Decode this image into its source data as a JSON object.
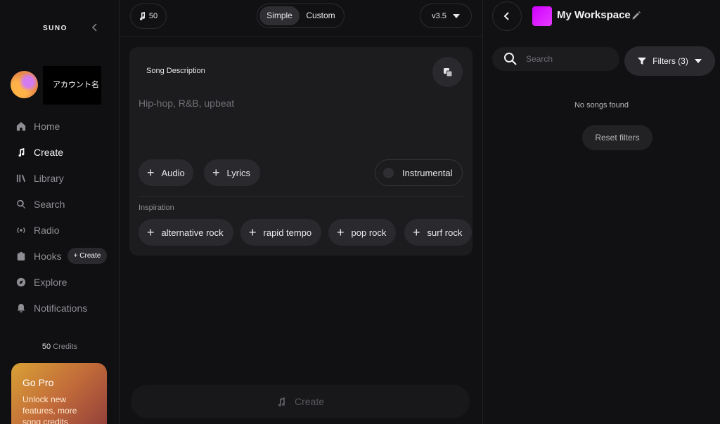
{
  "sidebar": {
    "logo": "SUNO",
    "collapse_icon": "chevron-left-icon",
    "account_name": "アカウント名",
    "nav": [
      {
        "label": "Home",
        "icon": "home-icon"
      },
      {
        "label": "Create",
        "icon": "music-sparkle-icon",
        "active": true
      },
      {
        "label": "Library",
        "icon": "library-icon"
      },
      {
        "label": "Search",
        "icon": "search-icon"
      },
      {
        "label": "Radio",
        "icon": "radio-icon"
      },
      {
        "label": "Hooks",
        "icon": "hooks-icon"
      },
      {
        "label": "Explore",
        "icon": "compass-icon"
      },
      {
        "label": "Notifications",
        "icon": "bell-icon"
      }
    ],
    "hooks_create": "Create",
    "credits_value": "50",
    "credits_label": "Credits",
    "gopro": {
      "title": "Go Pro",
      "desc_line1": "Unlock new",
      "desc_line2": "features, more",
      "desc_line3": "song credits"
    }
  },
  "topbar": {
    "credits": "50",
    "mode_simple": "Simple",
    "mode_custom": "Custom",
    "version": "v3.5"
  },
  "composer": {
    "label": "Song Description",
    "placeholder": "Hip-hop, R&B, upbeat",
    "audio": "Audio",
    "lyrics": "Lyrics",
    "instrumental": "Instrumental",
    "inspiration_label": "Inspiration",
    "inspiration": [
      "alternative rock",
      "rapid tempo",
      "pop rock",
      "surf rock"
    ],
    "create": "Create"
  },
  "workspace": {
    "title": "My Workspace",
    "search_placeholder": "Search",
    "filters": "Filters (3)",
    "empty": "No songs found",
    "reset": "Reset filters",
    "thumb_color": "#d900ff"
  }
}
